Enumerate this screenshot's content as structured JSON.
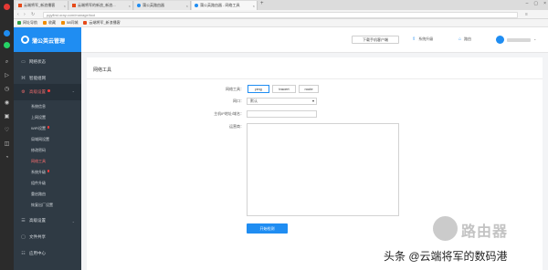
{
  "browser": {
    "tabs": [
      {
        "title": "云端将军_新浪播客",
        "color": "#e64a19",
        "active": false
      },
      {
        "title": "云端将军的新浪_新浪...",
        "color": "#e64a19",
        "active": false
      },
      {
        "title": "蒲公英路由器",
        "color": "#1f8df2",
        "active": false
      },
      {
        "title": "蒲公英路由器 - 网络工具",
        "color": "#1f8df2",
        "active": true
      }
    ],
    "new_tab_glyph": "+",
    "address": "pgyfirst.oray.com/manage/tool",
    "bookmarks": [
      {
        "label": "网址导航",
        "color": "#2f9e44"
      },
      {
        "label": "收藏",
        "color": "#f08c00"
      },
      {
        "label": "58同城",
        "color": "#f08c00"
      },
      {
        "label": "云端将军_新浪播客",
        "color": "#e64a19"
      }
    ]
  },
  "app": {
    "brand": "蒲公英云管理",
    "brand_color": "#1f8df2",
    "nav": [
      {
        "label": "网络状态",
        "icon": "monitor-icon",
        "glyph": "▭"
      },
      {
        "label": "智能组网",
        "icon": "network-icon",
        "glyph": "⌘"
      },
      {
        "label": "高级设置",
        "icon": "gear-icon",
        "glyph": "⚙",
        "expanded": true,
        "badge": true
      },
      {
        "label": "高级设置",
        "icon": "settings-icon",
        "glyph": "☰"
      },
      {
        "label": "文件共享",
        "icon": "folder-icon",
        "glyph": "▢"
      },
      {
        "label": "应用中心",
        "icon": "apps-icon",
        "glyph": "☷"
      }
    ],
    "subnav": [
      {
        "label": "系统信息"
      },
      {
        "label": "上网设置"
      },
      {
        "label": "WiFi设置",
        "badge": true
      },
      {
        "label": "局域网设置"
      },
      {
        "label": "修改密码"
      },
      {
        "label": "网络工具",
        "active": true
      },
      {
        "label": "系统升级",
        "badge": true
      },
      {
        "label": "组件升级"
      },
      {
        "label": "重启路由"
      },
      {
        "label": "恢复出厂设置"
      }
    ],
    "header": {
      "download_button": "下载手机客户端",
      "upgrade_label": "系统升级",
      "router_label": "路由"
    }
  },
  "page": {
    "title": "网络工具",
    "tool_label": "网络工具：",
    "tools": [
      "ping",
      "tracert",
      "route"
    ],
    "selected_tool": "ping",
    "port_label": "网口：",
    "port_value": "默认",
    "host_label": "主机IP地址/域名：",
    "host_value": "",
    "result_label": "运营商：",
    "start_button": "开始检测"
  },
  "watermarks": {
    "router_logo": "路由器",
    "credit": "头条 @云端将军的数码港"
  }
}
